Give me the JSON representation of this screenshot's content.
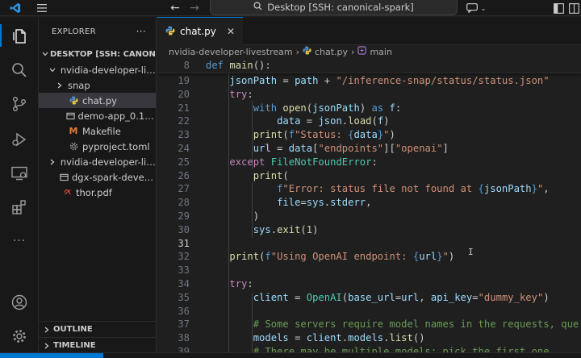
{
  "window": {
    "command_center": "Desktop [SSH: canonical-spark]"
  },
  "activity_bar": {
    "items": [
      "explorer",
      "search",
      "source-control",
      "run-debug",
      "remote-explorer",
      "extensions",
      "more"
    ]
  },
  "sidebar": {
    "title": "EXPLORER",
    "more": "···",
    "root": "DESKTOP [SSH: CANONIC...",
    "tree": [
      {
        "label": "nvidia-developer-live...",
        "indent": 1,
        "chev": "down",
        "icon": ""
      },
      {
        "label": "snap",
        "indent": 2,
        "chev": "right",
        "icon": ""
      },
      {
        "label": "chat.py",
        "indent": 2,
        "chev": "",
        "icon": "python",
        "selected": true
      },
      {
        "label": "demo-app_0.1_arm...",
        "indent": 2,
        "chev": "",
        "icon": "package"
      },
      {
        "label": "Makefile",
        "indent": 2,
        "chev": "",
        "icon": "makefile"
      },
      {
        "label": "pyproject.toml",
        "indent": 2,
        "chev": "",
        "icon": "gear"
      },
      {
        "label": "nvidia-developer-live...",
        "indent": 1,
        "chev": "right",
        "icon": ""
      },
      {
        "label": "dgx-spark-developer...",
        "indent": 1,
        "chev": "",
        "icon": "package"
      },
      {
        "label": "thor.pdf",
        "indent": 1,
        "chev": "",
        "icon": "pdf"
      }
    ],
    "outline": "OUTLINE",
    "timeline": "TIMELINE"
  },
  "editor": {
    "tab": "chat.py",
    "breadcrumbs": [
      "nvidia-developer-livestream",
      "chat.py",
      "main"
    ],
    "sticky": {
      "num": "8",
      "code": "def main():"
    },
    "lines": [
      {
        "num": "19",
        "code": "    jsonPath = path + \"/inference-snap/status/status.json\""
      },
      {
        "num": "20",
        "code": "    try:"
      },
      {
        "num": "21",
        "code": "        with open(jsonPath) as f:"
      },
      {
        "num": "22",
        "code": "            data = json.load(f)"
      },
      {
        "num": "23",
        "code": "        print(f\"Status: {data}\")"
      },
      {
        "num": "24",
        "code": "        url = data[\"endpoints\"][\"openai\"]"
      },
      {
        "num": "25",
        "code": "    except FileNotFoundError:"
      },
      {
        "num": "26",
        "code": "        print("
      },
      {
        "num": "27",
        "code": "            f\"Error: status file not found at {jsonPath}\","
      },
      {
        "num": "28",
        "code": "            file=sys.stderr,"
      },
      {
        "num": "29",
        "code": "        )"
      },
      {
        "num": "30",
        "code": "        sys.exit(1)"
      },
      {
        "num": "31",
        "code": ""
      },
      {
        "num": "32",
        "code": "    print(f\"Using OpenAI endpoint: {url}\")"
      },
      {
        "num": "33",
        "code": ""
      },
      {
        "num": "34",
        "code": "    try:"
      },
      {
        "num": "35",
        "code": "        client = OpenAI(base_url=url, api_key=\"dummy_key\")"
      },
      {
        "num": "36",
        "code": ""
      },
      {
        "num": "37",
        "code": "        # Some servers require model names in the requests, que"
      },
      {
        "num": "38",
        "code": "        models = client.models.list()"
      },
      {
        "num": "39",
        "code": "        # There may be multiple models; pick the first one"
      }
    ],
    "current_line": "31"
  },
  "colors": {
    "accent": "#0078d4",
    "keyword": "#569cd6",
    "control": "#c586c0",
    "function": "#dcdcaa",
    "string": "#ce9178",
    "variable": "#9cdcfe",
    "class": "#4ec9b0",
    "number": "#b5cea8",
    "comment": "#6a9955"
  }
}
